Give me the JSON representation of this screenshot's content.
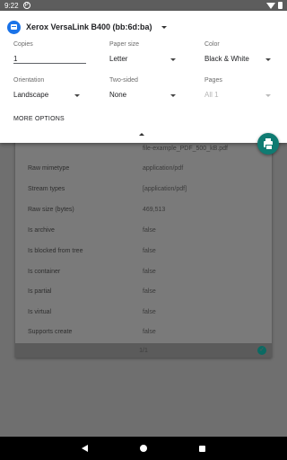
{
  "status_bar": {
    "time": "9:22",
    "notification_icon": "circle-p"
  },
  "printer": {
    "name": "Xerox VersaLink B400 (bb:6d:ba)"
  },
  "options": {
    "copies": {
      "label": "Copies",
      "value": "1"
    },
    "paper_size": {
      "label": "Paper size",
      "value": "Letter"
    },
    "color": {
      "label": "Color",
      "value": "Black & White"
    },
    "orientation": {
      "label": "Orientation",
      "value": "Landscape"
    },
    "two_sided": {
      "label": "Two-sided",
      "value": "None"
    },
    "pages": {
      "label": "Pages",
      "value": "All 1"
    }
  },
  "more_options_label": "MORE OPTIONS",
  "document": {
    "filename": "file-example_PDF_500_kB.pdf",
    "rows": [
      {
        "key": "Raw mimetype",
        "value": "application/pdf"
      },
      {
        "key": "Stream types",
        "value": "[application/pdf]"
      },
      {
        "key": "Raw size (bytes)",
        "value": "469,513"
      },
      {
        "key": "Is archive",
        "value": "false"
      },
      {
        "key": "Is blocked from tree",
        "value": "false"
      },
      {
        "key": "Is container",
        "value": "false"
      },
      {
        "key": "Is partial",
        "value": "false"
      },
      {
        "key": "Is virtual",
        "value": "false"
      },
      {
        "key": "Supports create",
        "value": "false"
      }
    ],
    "page_indicator": "1/1"
  },
  "colors": {
    "accent": "#0f7b72",
    "printer_icon": "#1a73e8"
  }
}
